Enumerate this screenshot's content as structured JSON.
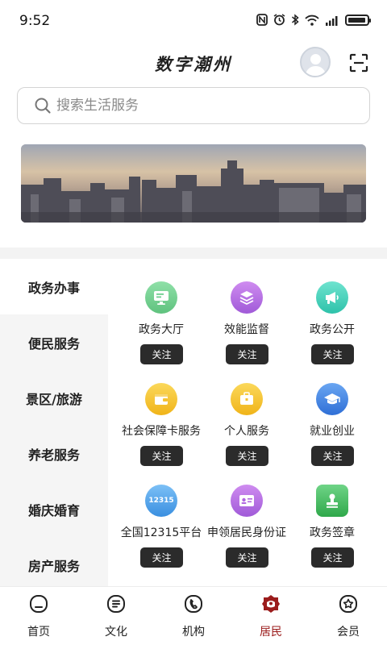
{
  "status_bar": {
    "time": "9:52"
  },
  "header": {
    "title": "数字潮州"
  },
  "search": {
    "placeholder": "搜索生活服务"
  },
  "sidebar": {
    "items": [
      {
        "label": "政务办事",
        "active": true
      },
      {
        "label": "便民服务",
        "active": false
      },
      {
        "label": "景区/旅游",
        "active": false
      },
      {
        "label": "养老服务",
        "active": false
      },
      {
        "label": "婚庆婚育",
        "active": false
      },
      {
        "label": "房产服务",
        "active": false
      }
    ]
  },
  "services": [
    {
      "label": "政务大厅",
      "icon": "monitor-icon",
      "color": "#6fcf8f",
      "follow": "关注"
    },
    {
      "label": "效能监督",
      "icon": "layers-icon",
      "color": "#b066e0",
      "follow": "关注"
    },
    {
      "label": "政务公开",
      "icon": "megaphone-icon",
      "color": "#3fcfb8",
      "follow": "关注"
    },
    {
      "label": "社会保障卡服务",
      "icon": "wallet-icon",
      "color": "#f5c232",
      "follow": "关注"
    },
    {
      "label": "个人服务",
      "icon": "briefcase-icon",
      "color": "#f5c232",
      "follow": "关注"
    },
    {
      "label": "就业创业",
      "icon": "graduation-cap-icon",
      "color": "#3f7fe0",
      "follow": "关注"
    },
    {
      "label": "全国12315平台",
      "icon": "badge-12315-icon",
      "icon_text": "12315",
      "color": "#4a9fe8",
      "follow": "关注"
    },
    {
      "label": "申领居民身份证",
      "icon": "id-card-icon",
      "color": "#b066e0",
      "follow": "关注"
    },
    {
      "label": "政务签章",
      "icon": "stamp-icon",
      "color": "#3fb85a",
      "follow": "关注"
    }
  ],
  "bottom_nav": {
    "items": [
      {
        "label": "首页",
        "icon": "home-icon",
        "active": false
      },
      {
        "label": "文化",
        "icon": "book-icon",
        "active": false
      },
      {
        "label": "机构",
        "icon": "institution-icon",
        "active": false
      },
      {
        "label": "居民",
        "icon": "resident-icon",
        "active": true
      },
      {
        "label": "会员",
        "icon": "member-icon",
        "active": false
      }
    ],
    "active_color": "#9b1c1c"
  }
}
